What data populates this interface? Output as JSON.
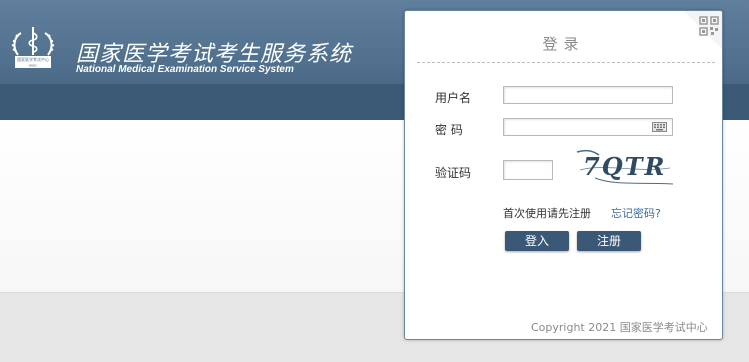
{
  "header": {
    "title": "国家医学考试考生服务系统",
    "subtitle": "National Medical Examination Service System",
    "logo_text": "国家医学考试中心"
  },
  "login": {
    "title": "登录",
    "username_label": "用户名",
    "username_value": "",
    "password_label": "密 码",
    "password_value": "",
    "captcha_label": "验证码",
    "captcha_value": "",
    "captcha_image_text": "7QTR",
    "first_use_link": "首次使用请先注册",
    "forgot_password_link": "忘记密码?",
    "login_button": "登入",
    "register_button": "注册"
  },
  "footer": {
    "copyright": "Copyright 2021 国家医学考试中心"
  },
  "icons": {
    "logo": "medical-emblem-icon",
    "qr": "qr-code-icon",
    "keyboard": "keyboard-icon"
  },
  "colors": {
    "header": "#4f6f8d",
    "button": "#3b5876",
    "link": "#3d6a99",
    "panel_border": "#6b879f"
  }
}
